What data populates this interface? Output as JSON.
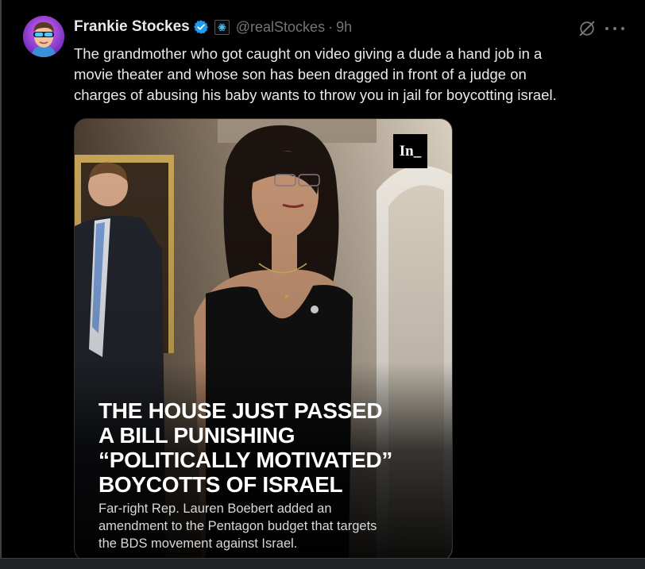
{
  "author": {
    "display_name": "Frankie Stockes",
    "handle": "@realStockes",
    "separator": "·",
    "time": "9h",
    "verified_icon": "verified-badge-icon",
    "affiliation_icon": "affiliate-badge-icon"
  },
  "actions": {
    "grok_icon": "grok-icon",
    "more_icon": "more-options-icon"
  },
  "tweet": {
    "text_lines": [
      "The grandmother who got caught on video giving a dude a hand job in a",
      "movie theater and whose son has been dragged in front of a judge on",
      "charges of abusing his baby wants to throw you in jail for boycotting israel."
    ]
  },
  "media": {
    "logo": "In_",
    "headline_lines": [
      "THE HOUSE JUST PASSED",
      "A BILL PUNISHING",
      "“POLITICALLY MOTIVATED”",
      "BOYCOTTS OF ISRAEL"
    ],
    "subhead_lines": [
      "Far-right Rep. Lauren Boebert added an",
      "amendment to the Pentagon budget that targets",
      "the BDS movement against Israel."
    ]
  },
  "colors": {
    "background": "#000000",
    "text": "#e7e9ea",
    "muted": "#71767b",
    "verified": "#1d9bf0"
  }
}
